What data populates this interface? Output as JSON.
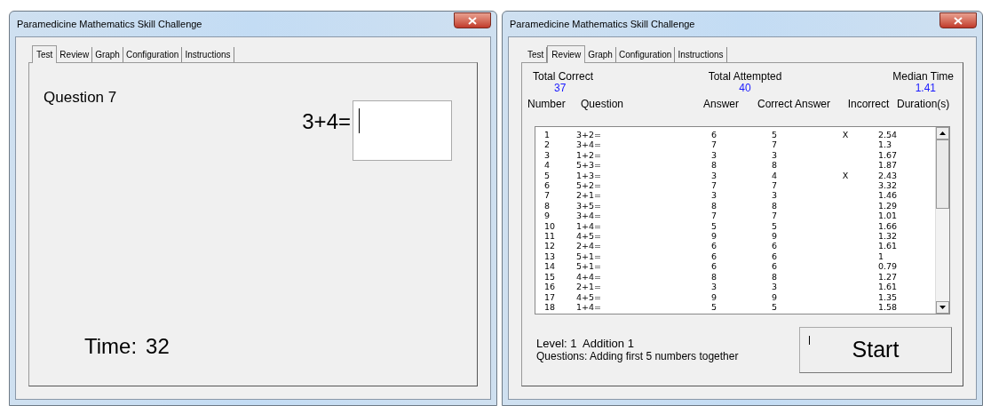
{
  "test_window": {
    "title": "Paramedicine Mathematics Skill Challenge",
    "tabs": [
      {
        "label": "Test",
        "selected": true
      },
      {
        "label": "Review",
        "selected": false
      },
      {
        "label": "Graph",
        "selected": false
      },
      {
        "label": "Configuration",
        "selected": false
      },
      {
        "label": "Instructions",
        "selected": false
      }
    ],
    "question_label": "Question 7",
    "expression": "3+4=",
    "timer_label": "Time:",
    "timer_value": "32"
  },
  "review_window": {
    "title": "Paramedicine Mathematics Skill Challenge",
    "tabs": [
      {
        "label": "Test",
        "selected": false
      },
      {
        "label": "Review",
        "selected": true
      },
      {
        "label": "Graph",
        "selected": false
      },
      {
        "label": "Configuration",
        "selected": false
      },
      {
        "label": "Instructions",
        "selected": false
      }
    ],
    "stats": [
      {
        "label": "Total Correct",
        "value": "37"
      },
      {
        "label": "Total Attempted",
        "value": "40"
      },
      {
        "label": "Median Time",
        "value": "1.41"
      }
    ],
    "columns": [
      "Number",
      "Question",
      "Answer",
      "Correct Answer",
      "Incorrect",
      "Duration(s)"
    ],
    "rows": [
      [
        "1",
        "3+2=",
        "6",
        "5",
        "X",
        "2.54"
      ],
      [
        "2",
        "3+4=",
        "7",
        "7",
        "",
        "1.3"
      ],
      [
        "3",
        "1+2=",
        "3",
        "3",
        "",
        "1.67"
      ],
      [
        "4",
        "5+3=",
        "8",
        "8",
        "",
        "1.87"
      ],
      [
        "5",
        "1+3=",
        "3",
        "4",
        "X",
        "2.43"
      ],
      [
        "6",
        "5+2=",
        "7",
        "7",
        "",
        "3.32"
      ],
      [
        "7",
        "2+1=",
        "3",
        "3",
        "",
        "1.46"
      ],
      [
        "8",
        "3+5=",
        "8",
        "8",
        "",
        "1.29"
      ],
      [
        "9",
        "3+4=",
        "7",
        "7",
        "",
        "1.01"
      ],
      [
        "10",
        "1+4=",
        "5",
        "5",
        "",
        "1.66"
      ],
      [
        "11",
        "4+5=",
        "9",
        "9",
        "",
        "1.32"
      ],
      [
        "12",
        "2+4=",
        "6",
        "6",
        "",
        "1.61"
      ],
      [
        "13",
        "5+1=",
        "6",
        "6",
        "",
        "1"
      ],
      [
        "14",
        "5+1=",
        "6",
        "6",
        "",
        "0.79"
      ],
      [
        "15",
        "4+4=",
        "8",
        "8",
        "",
        "1.27"
      ],
      [
        "16",
        "2+1=",
        "3",
        "3",
        "",
        "1.61"
      ],
      [
        "17",
        "4+5=",
        "9",
        "9",
        "",
        "1.35"
      ],
      [
        "18",
        "1+4=",
        "5",
        "5",
        "",
        "1.58"
      ]
    ],
    "level_line": "Level: 1  Addition 1",
    "questions_line": "Questions: Adding first 5 numbers together",
    "start_button": "Start"
  }
}
